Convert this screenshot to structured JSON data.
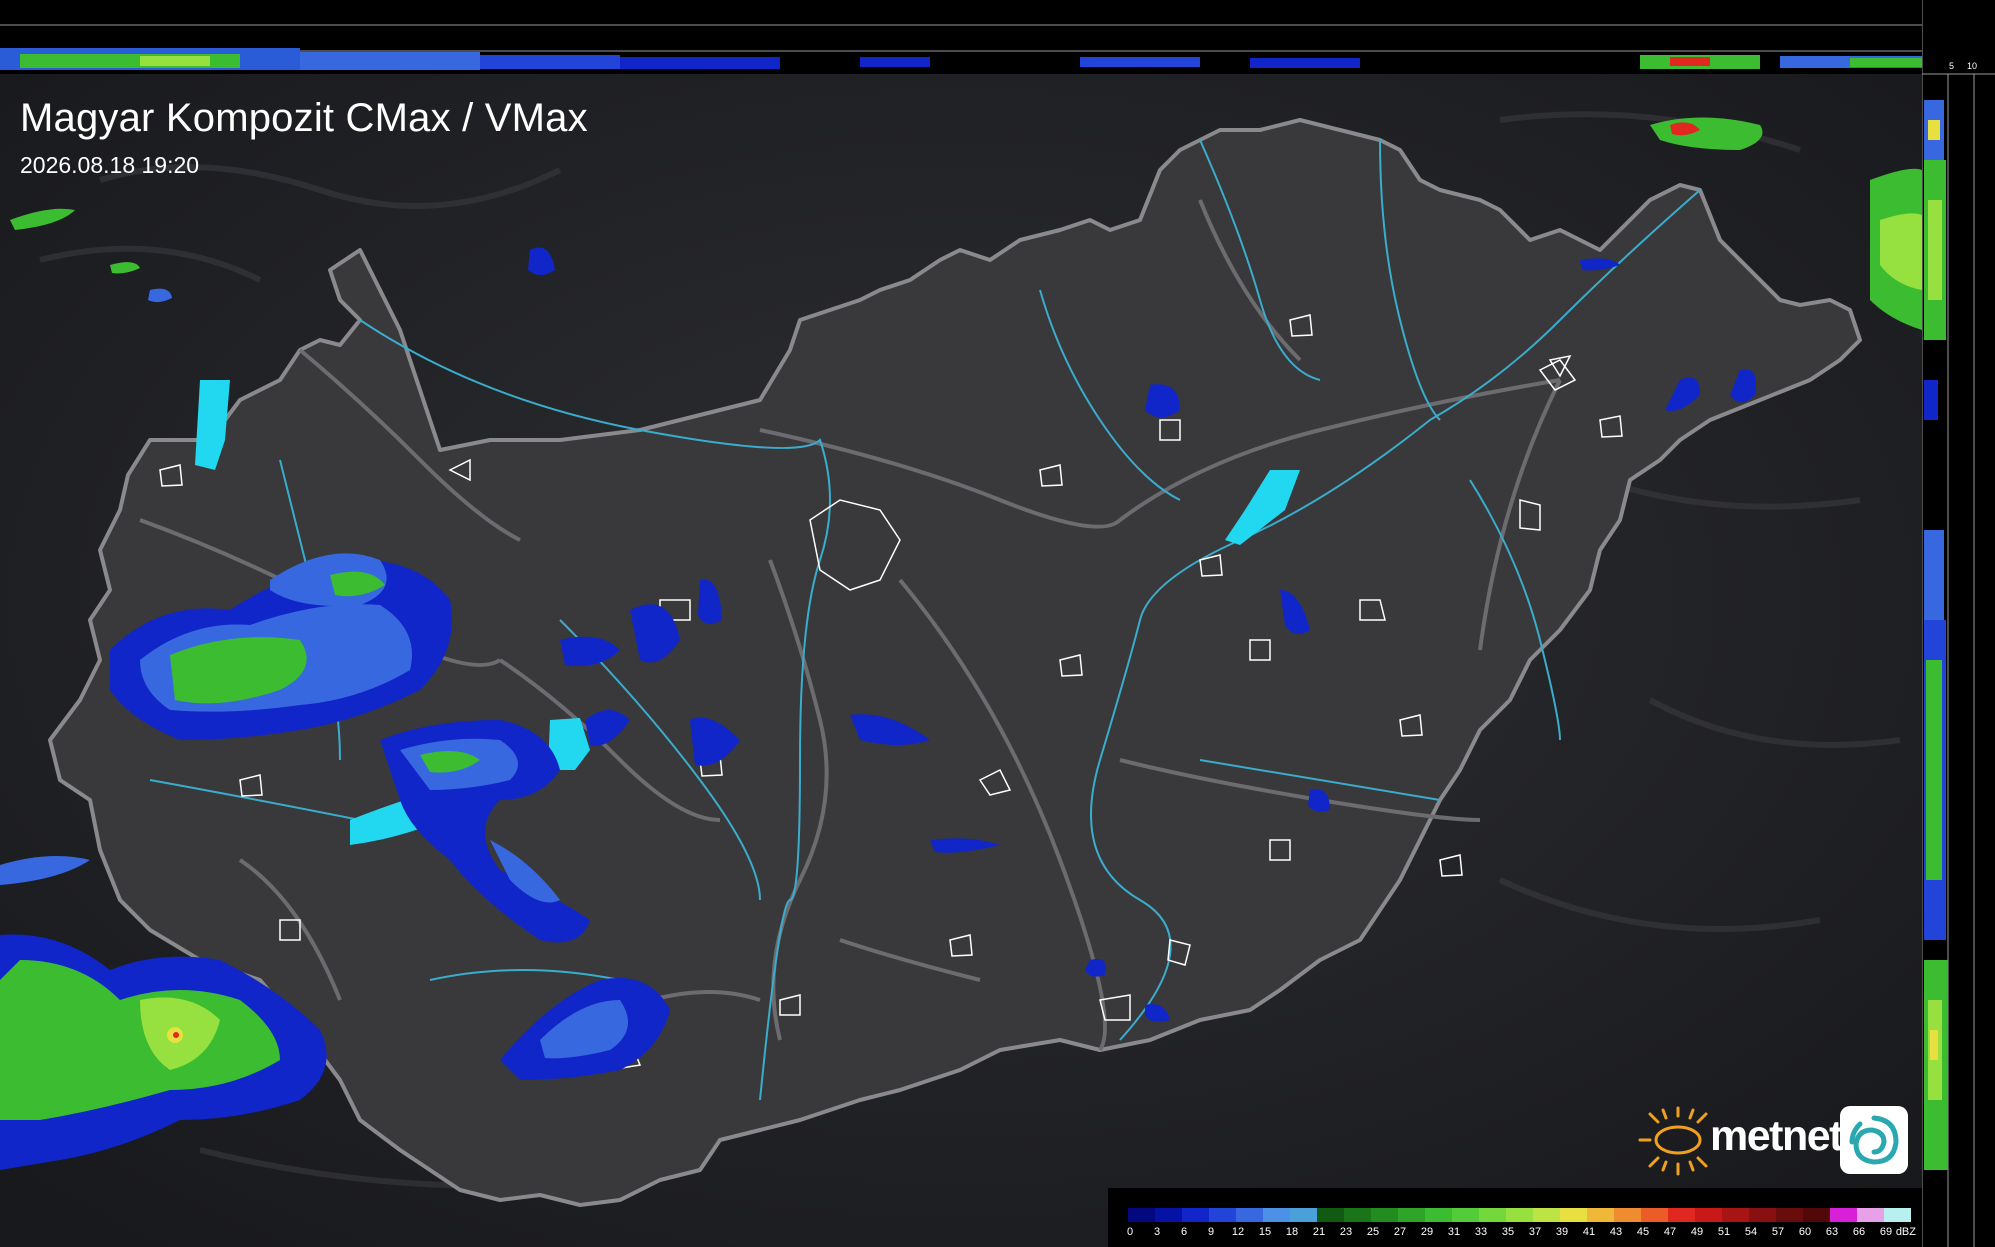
{
  "header": {
    "title": "Magyar Kompozit CMax / VMax",
    "timestamp": "2026.08.18 19:20"
  },
  "profile_scales": {
    "top": [
      "10",
      "5"
    ],
    "right": [
      "5",
      "10"
    ]
  },
  "legend": {
    "unit": "dBZ",
    "ticks": [
      "0",
      "3",
      "6",
      "9",
      "12",
      "15",
      "18",
      "21",
      "23",
      "25",
      "27",
      "29",
      "31",
      "33",
      "35",
      "37",
      "39",
      "41",
      "43",
      "45",
      "47",
      "49",
      "51",
      "54",
      "57",
      "60",
      "63",
      "66",
      "69"
    ],
    "colors": [
      "#04087e",
      "#0612a6",
      "#1026c8",
      "#2344d8",
      "#3768e0",
      "#4c90e8",
      "#4aa0d8",
      "#125a12",
      "#1a7418",
      "#238c20",
      "#2ea428",
      "#3cbc30",
      "#52cc38",
      "#74d83c",
      "#96e040",
      "#bce444",
      "#e8e040",
      "#f0b838",
      "#f08c30",
      "#ec5c28",
      "#e02820",
      "#c81818",
      "#a81414",
      "#881010",
      "#680c0c",
      "#500808",
      "#d820d8",
      "#e8a0e8",
      "#b8f0f0"
    ]
  },
  "logo": {
    "brand": "metnet",
    "sun_icon": "sun-icon",
    "badge_icon": "swirl-icon"
  },
  "colors": {
    "country_fill": "#39393c",
    "border": "#8a8a8e",
    "river": "#3aaccc",
    "city_outline": "#ffffff",
    "lake": "#22d8f0",
    "logo_sun": "#f0a020",
    "logo_badge_swirl": "#2aa8b0"
  }
}
